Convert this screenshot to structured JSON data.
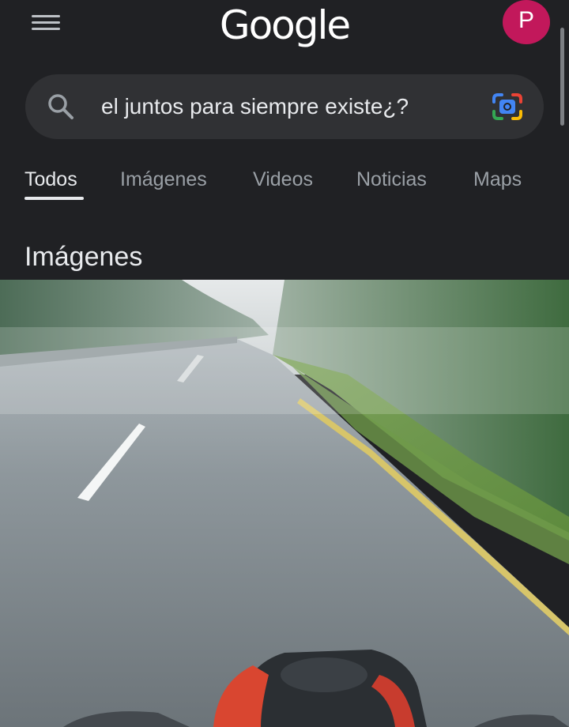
{
  "header": {
    "logo_text": "Google",
    "avatar_initial": "P"
  },
  "search": {
    "query": "el juntos para siempre existe¿?"
  },
  "tabs": [
    {
      "label": "Todos",
      "active": true
    },
    {
      "label": "Imágenes",
      "active": false
    },
    {
      "label": "Videos",
      "active": false
    },
    {
      "label": "Noticias",
      "active": false
    },
    {
      "label": "Maps",
      "active": false
    }
  ],
  "section": {
    "title": "Imágenes"
  },
  "colors": {
    "background": "#202124",
    "search_box": "#303134",
    "avatar": "#c2185b"
  },
  "icons": {
    "menu": "hamburger-menu-icon",
    "search": "search-icon",
    "lens": "google-lens-icon"
  }
}
